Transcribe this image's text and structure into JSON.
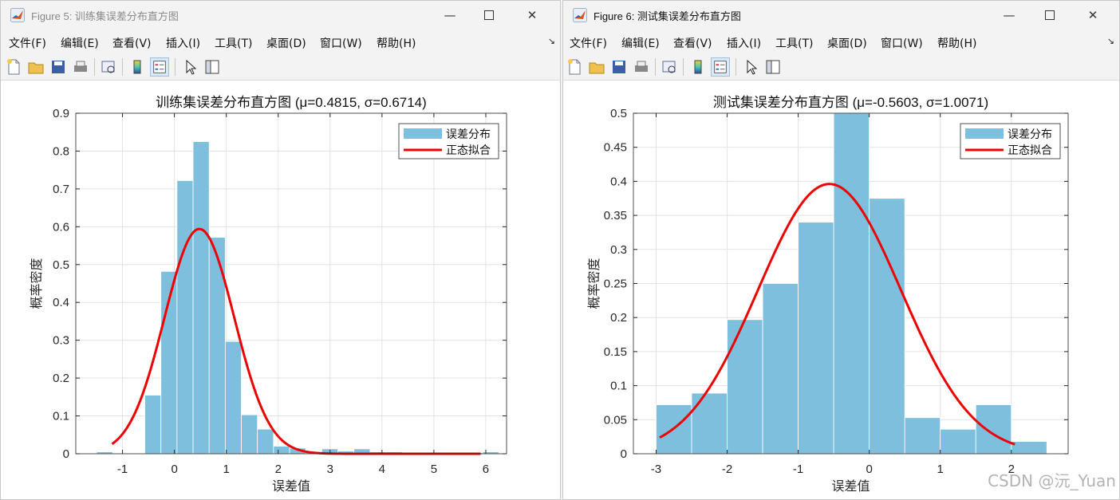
{
  "figure_left": {
    "title": "Figure 5: 训练集误差分布直方图",
    "menu": [
      "文件(F)",
      "编辑(E)",
      "查看(V)",
      "插入(I)",
      "工具(T)",
      "桌面(D)",
      "窗口(W)",
      "帮助(H)"
    ]
  },
  "figure_right": {
    "title": "Figure 6: 测试集误差分布直方图",
    "menu": [
      "文件(F)",
      "编辑(E)",
      "查看(V)",
      "插入(I)",
      "工具(T)",
      "桌面(D)",
      "窗口(W)",
      "帮助(H)"
    ]
  },
  "toolbar_icons": [
    "new-figure-icon",
    "open-file-icon",
    "save-icon",
    "print-icon",
    "print-preview-icon",
    "colorbar-icon",
    "legend-icon",
    "pointer-icon",
    "plot-tools-icon"
  ],
  "colors": {
    "bars": "#7fbfde",
    "fit_line": "#ee0000"
  },
  "watermark": "CSDN @沅_Yuan",
  "chart_data": [
    {
      "type": "bar",
      "title": "训练集误差分布直方图 (μ=0.4815, σ=0.6714)",
      "xlabel": "误差值",
      "ylabel": "概率密度",
      "xlim": [
        -1.9,
        6.4
      ],
      "ylim": [
        0,
        0.9
      ],
      "xticks": [
        -1,
        0,
        1,
        2,
        3,
        4,
        5,
        6
      ],
      "yticks": [
        0,
        0.1,
        0.2,
        0.3,
        0.4,
        0.5,
        0.6,
        0.7,
        0.8,
        0.9
      ],
      "grid": true,
      "legend": {
        "position": "top-right",
        "entries": [
          "误差分布",
          "正态拟合"
        ]
      },
      "bin_edges": [
        -1.5,
        -1.19,
        -0.88,
        -0.57,
        -0.26,
        0.05,
        0.36,
        0.67,
        0.98,
        1.29,
        1.6,
        1.91,
        2.22,
        2.53,
        2.84,
        3.15,
        3.46,
        3.77,
        4.08,
        4.39,
        4.7,
        5.01,
        5.32,
        5.63,
        5.94,
        6.25
      ],
      "values": [
        0.005,
        0,
        0,
        0.155,
        0.482,
        0.722,
        0.825,
        0.572,
        0.297,
        0.103,
        0.065,
        0.02,
        0.015,
        0.005,
        0.013,
        0.007,
        0.013,
        0.005,
        0.005,
        0.003,
        0.003,
        0.003,
        0.003,
        0.003,
        0.005
      ],
      "fit": {
        "name": "正态拟合",
        "mu": 0.4815,
        "sigma": 0.6714,
        "x_range": [
          -1.2,
          5.9
        ]
      },
      "series": [
        {
          "name": "误差分布",
          "kind": "histogram"
        },
        {
          "name": "正态拟合",
          "kind": "line"
        }
      ]
    },
    {
      "type": "bar",
      "title": "测试集误差分布直方图 (μ=-0.5603, σ=1.0071)",
      "xlabel": "误差值",
      "ylabel": "概率密度",
      "xlim": [
        -3.32,
        2.8
      ],
      "ylim": [
        0,
        0.5
      ],
      "xticks": [
        -3,
        -2,
        -1,
        0,
        1,
        2
      ],
      "yticks": [
        0,
        0.05,
        0.1,
        0.15,
        0.2,
        0.25,
        0.3,
        0.35,
        0.4,
        0.45,
        0.5
      ],
      "grid": true,
      "legend": {
        "position": "top-right",
        "entries": [
          "误差分布",
          "正态拟合"
        ]
      },
      "bin_edges": [
        -3.0,
        -2.5,
        -2.0,
        -1.5,
        -1.0,
        -0.5,
        0.0,
        0.5,
        1.0,
        1.5,
        2.0,
        2.5
      ],
      "values": [
        0.072,
        0.089,
        0.197,
        0.25,
        0.34,
        0.5,
        0.375,
        0.053,
        0.036,
        0.072,
        0.018
      ],
      "fit": {
        "name": "正态拟合",
        "mu": -0.5603,
        "sigma": 1.0071,
        "x_range": [
          -2.95,
          2.05
        ]
      },
      "series": [
        {
          "name": "误差分布",
          "kind": "histogram"
        },
        {
          "name": "正态拟合",
          "kind": "line"
        }
      ]
    }
  ]
}
